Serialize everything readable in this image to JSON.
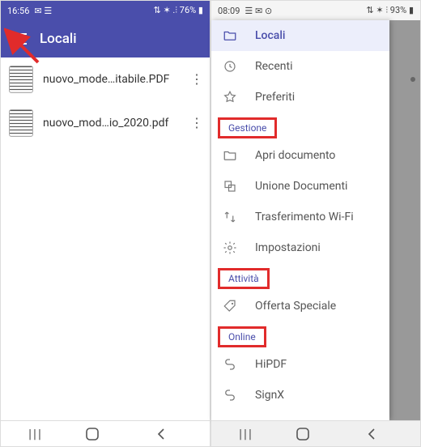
{
  "left": {
    "status": {
      "time": "16:56",
      "icons": "✉ ☰",
      "net": "⇅ ✶ .⫶ 76% ▮"
    },
    "title": "Locali",
    "files": [
      {
        "name": "nuovo_mode…itabile.PDF"
      },
      {
        "name": "nuovo_mod…io_2020.pdf"
      }
    ],
    "nav": {
      "recent": "|||"
    }
  },
  "right": {
    "status": {
      "time": "08:09",
      "icons": "☰ ✉ ⊙",
      "net": "⇅ ✶ ⫶ 93% ▮"
    },
    "drawer": {
      "top": [
        {
          "icon": "folder",
          "label": "Locali",
          "active": true
        },
        {
          "icon": "clock",
          "label": "Recenti"
        },
        {
          "icon": "star",
          "label": "Preferiti"
        }
      ],
      "sections": [
        {
          "heading": "Gestione",
          "items": [
            {
              "icon": "folder",
              "label": "Apri documento"
            },
            {
              "icon": "merge",
              "label": "Unione Documenti"
            },
            {
              "icon": "wifi",
              "label": "Trasferimento Wi-Fi"
            },
            {
              "icon": "gear",
              "label": "Impostazioni"
            }
          ]
        },
        {
          "heading": "Attività",
          "items": [
            {
              "icon": "tag",
              "label": "Offerta Speciale"
            }
          ]
        },
        {
          "heading": "Online",
          "items": [
            {
              "icon": "link",
              "label": "HiPDF"
            },
            {
              "icon": "link",
              "label": "SignX"
            }
          ]
        }
      ]
    }
  }
}
